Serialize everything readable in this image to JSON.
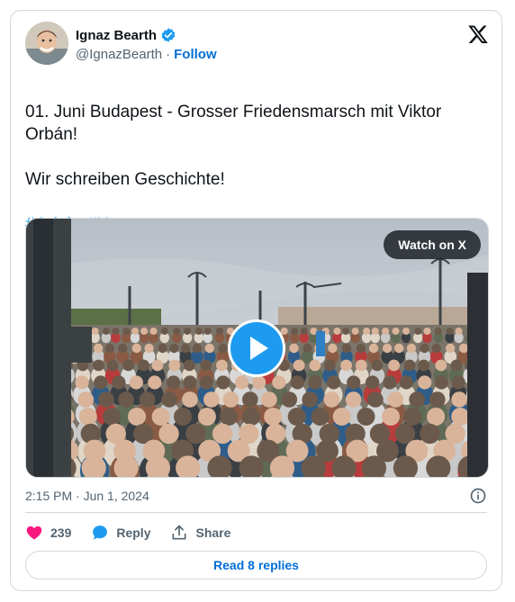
{
  "author": {
    "name": "Ignaz Bearth",
    "handle": "@IgnazBearth",
    "separator": "·",
    "follow_label": "Follow"
  },
  "tweet": {
    "line1": "01. Juni Budapest - Grosser Friedensmarsch mit Viktor Orbán!",
    "line2": "Wir schreiben Geschichte!",
    "hashtag1": "#Orbán",
    "hashtag2": "#Ungarn"
  },
  "media": {
    "watch_label": "Watch on X"
  },
  "meta": {
    "timestamp": "2:15 PM · Jun 1, 2024"
  },
  "actions": {
    "likes": "239",
    "reply_label": "Reply",
    "share_label": "Share"
  },
  "read_replies_label": "Read 8 replies",
  "colors": {
    "accent": "#1d9bf0",
    "like": "#f91880",
    "link": "#006fd6",
    "flag_red": "#ce2939",
    "flag_white": "#ffffff",
    "flag_green": "#477050"
  },
  "icons": {
    "verified": "verified-badge-icon",
    "x_logo": "x-logo-icon",
    "play": "play-icon",
    "info": "info-icon",
    "like": "heart-icon",
    "reply": "speech-bubble-icon",
    "share": "share-icon"
  }
}
